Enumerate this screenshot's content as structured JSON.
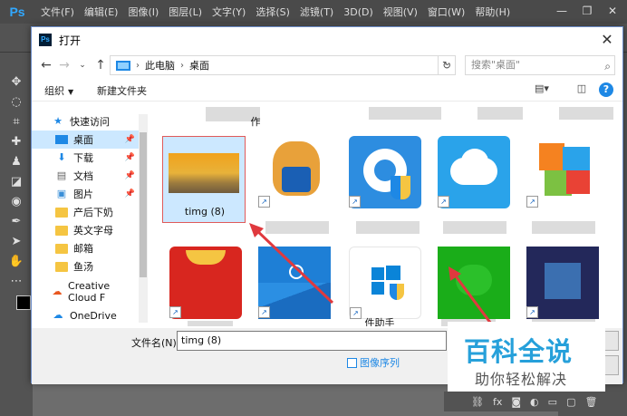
{
  "ps": {
    "logo": "Ps",
    "menus": [
      "文件(F)",
      "编辑(E)",
      "图像(I)",
      "图层(L)",
      "文字(Y)",
      "选择(S)",
      "滤镜(T)",
      "3D(D)",
      "视图(V)",
      "窗口(W)",
      "帮助(H)"
    ],
    "window_controls": [
      "—",
      "❐",
      "✕"
    ]
  },
  "dialog": {
    "title": "打开",
    "close": "✕",
    "breadcrumb": [
      "此电脑",
      "桌面"
    ],
    "search_placeholder": "搜索\"桌面\"",
    "toolbar": {
      "organize": "组织",
      "new_folder": "新建文件夹",
      "help": "?"
    },
    "nav": {
      "quick_access": "快速访问",
      "items": [
        {
          "label": "桌面",
          "pinned": true
        },
        {
          "label": "下载",
          "pinned": true
        },
        {
          "label": "文档",
          "pinned": true
        },
        {
          "label": "图片",
          "pinned": true
        },
        {
          "label": "产后下奶",
          "pinned": false
        },
        {
          "label": "英文字母",
          "pinned": false
        },
        {
          "label": "邮箱",
          "pinned": false
        },
        {
          "label": "鱼汤",
          "pinned": false
        }
      ],
      "creative_cloud": "Creative Cloud F",
      "onedrive": "OneDrive"
    },
    "files": {
      "top_partial_label": "作",
      "selected_label": "timg (8)",
      "bottom_partial_label": "件助手"
    },
    "filename_label": "文件名(N):",
    "filename_value": "timg (8)",
    "image_sequence": "图像序列"
  },
  "watermark": {
    "title": "百科全说",
    "subtitle": "助你轻松解决"
  },
  "colors": {
    "accent": "#1e88e5",
    "selection": "#cce8ff",
    "watermark": "#26a0da"
  }
}
